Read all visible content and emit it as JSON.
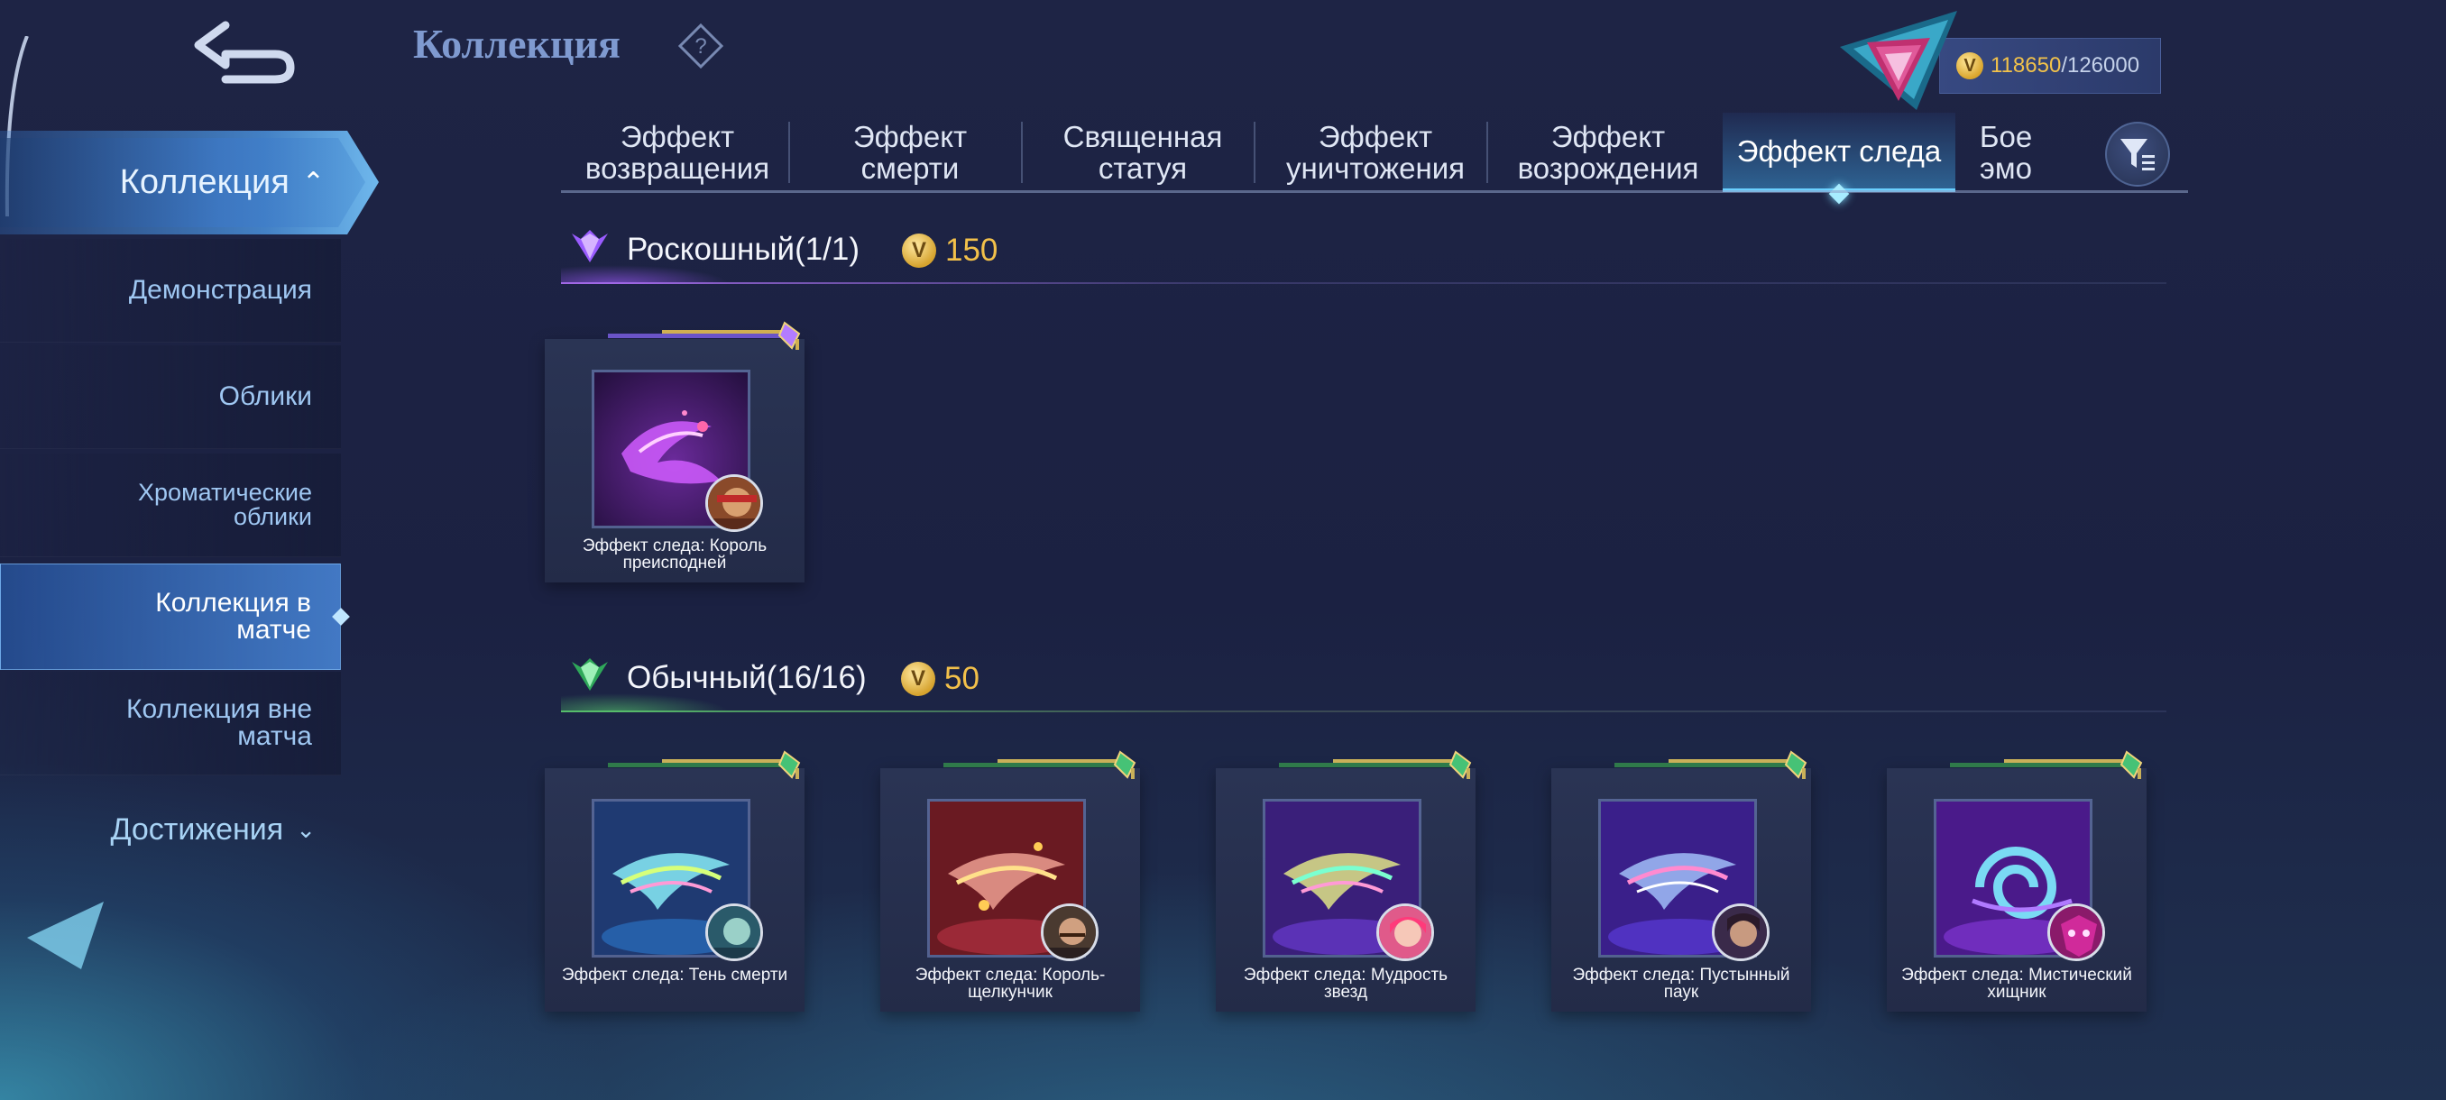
{
  "page": {
    "title": "Коллекция"
  },
  "currency": {
    "current": "118650",
    "max": "/126000"
  },
  "sidebar": {
    "active_section": "Коллекция",
    "items": [
      {
        "label": "Демонстрация"
      },
      {
        "label": "Облики"
      },
      {
        "label": "Хроматические облики"
      },
      {
        "label": "Коллекция в матче"
      },
      {
        "label": "Коллекция вне матча"
      }
    ],
    "achievements": "Достижения"
  },
  "tabs": [
    {
      "label": "Эффект возвращения"
    },
    {
      "label": "Эффект смерти"
    },
    {
      "label": "Священная статуя"
    },
    {
      "label": "Эффект уничтожения"
    },
    {
      "label": "Эффект возрождения"
    },
    {
      "label": "Эффект следа"
    },
    {
      "label": "Бое эмо"
    }
  ],
  "sections": {
    "luxury": {
      "name": "Роскошный",
      "count": "(1/1)",
      "price": "150",
      "items": [
        {
          "name": "Эффект следа: Король преисподней"
        }
      ]
    },
    "common": {
      "name": "Обычный",
      "count": "(16/16)",
      "price": "50",
      "items": [
        {
          "name": "Эффект следа: Тень смерти"
        },
        {
          "name": "Эффект следа: Король-щелкунчик"
        },
        {
          "name": "Эффект следа: Мудрость звезд"
        },
        {
          "name": "Эффект следа: Пустынный паук"
        },
        {
          "name": "Эффект следа: Мистический хищник"
        }
      ]
    }
  },
  "colors": {
    "accent": "#6ad0ff",
    "gold": "#f2c04a",
    "luxury": "#a86bff",
    "common": "#5ac86e"
  }
}
